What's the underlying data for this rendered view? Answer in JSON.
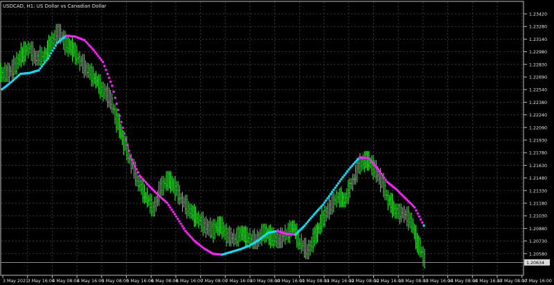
{
  "window": {
    "title": "USDCAD, H1:  US Dollar vs Canadian Dollar"
  },
  "colors": {
    "background": "#000000",
    "frame": "#bfbfbf",
    "grid": "#3b3b3b",
    "candle": "#32ff32",
    "ma_up": "#00e5ff",
    "ma_down": "#ff1fff",
    "price_line": "#8c8c8c",
    "text": "#e6e6e6"
  },
  "price_axis": {
    "labels": [
      "1.23420",
      "1.23280",
      "1.23140",
      "1.22980",
      "1.22830",
      "1.22690",
      "1.22540",
      "1.22380",
      "1.22240",
      "1.22090",
      "1.21930",
      "1.21780",
      "1.21630",
      "1.21480",
      "1.21330",
      "1.21180",
      "1.21030",
      "1.20880",
      "1.20730",
      "1.20580"
    ],
    "current_price_label": "1.20634"
  },
  "time_axis": {
    "labels": [
      "3 May 2021",
      "3 May 16:00",
      "4 May 08:00",
      "4 May 16:00",
      "5 May 08:00",
      "5 May 16:00",
      "6 May 08:00",
      "6 May 16:00",
      "7 May 08:00",
      "7 May 16:00",
      "10 May 08:00",
      "10 May 16:00",
      "11 May 08:00",
      "11 May 16:00",
      "12 May 08:00",
      "12 May 16:00",
      "13 May 08:00",
      "13 May 16:00",
      "14 May 08:00",
      "14 May 16:00",
      "17 May 08:00",
      "17 May 16:00"
    ]
  },
  "chart_data": {
    "type": "line",
    "title": "USDCAD, H1:  US Dollar vs Canadian Dollar",
    "ylim": [
      1.205,
      1.235
    ],
    "series": [
      {
        "name": "",
        "values": [
          1.227,
          1.2278,
          1.2292,
          1.2299,
          1.2288,
          1.229,
          1.2304,
          1.2318,
          1.2305,
          1.2298,
          1.2285,
          1.2275,
          1.2266,
          1.2254,
          1.2245,
          1.222,
          1.2195,
          1.2172,
          1.215,
          1.2135,
          1.2122,
          1.2145,
          1.2156,
          1.2145,
          1.213,
          1.212,
          1.2112,
          1.2104,
          1.2098,
          1.2106,
          1.2093,
          1.2089,
          1.2096,
          1.209,
          1.2086,
          1.2098,
          1.2092,
          1.2087,
          1.2094,
          1.2102,
          1.2084,
          1.2075,
          1.2092,
          1.211,
          1.2124,
          1.2135,
          1.2132,
          1.215,
          1.217,
          1.2178,
          1.2168,
          1.2154,
          1.2132,
          1.212,
          1.2118,
          1.211,
          1.2085,
          1.2065
        ]
      },
      {
        "name": "",
        "values": [
          1.2254,
          1.2262,
          1.2271,
          1.2272,
          1.2275,
          1.2288,
          1.2305,
          1.2313,
          1.2312,
          1.2308,
          1.2297,
          1.2284,
          1.2258,
          1.2218,
          1.218,
          1.2159,
          1.2148,
          1.2138,
          1.2129,
          1.2114,
          1.2098,
          1.2087,
          1.2079,
          1.2073,
          1.2072,
          1.2075,
          1.2078,
          1.2082,
          1.2088,
          1.2096,
          1.2098,
          1.2095,
          1.2094,
          1.2104,
          1.2116,
          1.2127,
          1.2141,
          1.2155,
          1.2168,
          1.2179,
          1.2178,
          1.2166,
          1.2152,
          1.2144,
          1.2134,
          1.2124,
          1.2104
        ]
      }
    ]
  }
}
